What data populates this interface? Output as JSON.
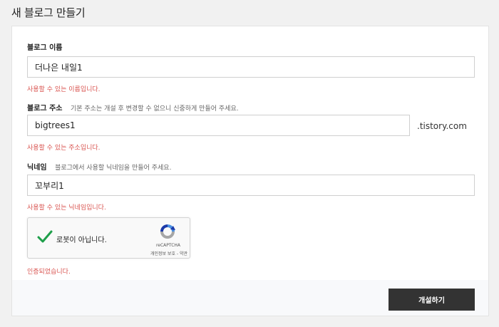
{
  "page": {
    "title": "새 블로그 만들기"
  },
  "form": {
    "blog_name": {
      "label": "블로그 이름",
      "value": "더나은 내일1",
      "message": "사용할 수 있는 이름입니다."
    },
    "blog_address": {
      "label": "블로그 주소",
      "hint": "기본 주소는 개설 후 변경할 수 없으니 신중하게 만들어 주세요.",
      "value": "bigtrees1",
      "suffix": ".tistory.com",
      "message": "사용할 수 있는 주소입니다."
    },
    "nickname": {
      "label": "닉네임",
      "hint": "블로그에서 사용할 닉네임을 만들어 주세요.",
      "value": "꼬부리1",
      "message": "사용할 수 있는 닉네임입니다."
    },
    "captcha": {
      "label": "로봇이 아닙니다.",
      "brand": "reCAPTCHA",
      "links": "개인정보 보호 - 약관",
      "message": "인증되었습니다."
    },
    "submit_label": "개설하기"
  },
  "colors": {
    "error_text": "#d9534f",
    "button_bg": "#333333",
    "check_green": "#1e9f4a"
  }
}
